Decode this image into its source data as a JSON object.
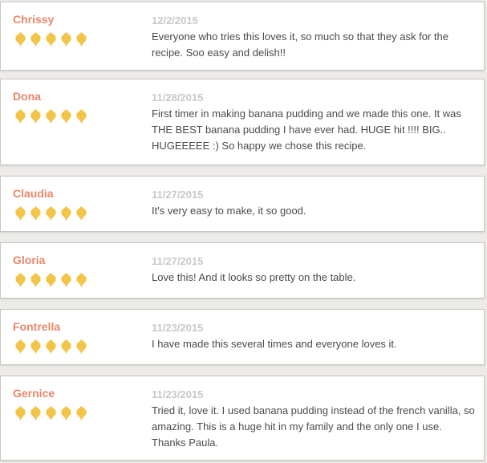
{
  "colors": {
    "name": "#e8866a",
    "date": "#c8c8c8",
    "text": "#4a4a4a",
    "star": "#f2c44a"
  },
  "reviews": [
    {
      "name": "Chrissy",
      "rating": 5,
      "date": "12/2/2015",
      "text": "Everyone who tries this loves it, so much so that they ask for the recipe. Soo easy and delish!!"
    },
    {
      "name": "Dona",
      "rating": 5,
      "date": "11/28/2015",
      "text": "First timer in making banana pudding and we made this one. It was THE BEST banana pudding I have ever had. HUGE hit !!!! BIG.. HUGEEEEE :) So happy we chose this recipe."
    },
    {
      "name": "Claudia",
      "rating": 5,
      "date": "11/27/2015",
      "text": "It's very easy to make, it so good."
    },
    {
      "name": "Gloria",
      "rating": 5,
      "date": "11/27/2015",
      "text": "Love this! And it looks so pretty on the table."
    },
    {
      "name": "Fontrella",
      "rating": 5,
      "date": "11/23/2015",
      "text": "I have made this several times and everyone loves it."
    },
    {
      "name": "Gernice",
      "rating": 5,
      "date": "11/23/2015",
      "text": "Tried it, love it. I used banana pudding instead of the french vanilla, so amazing. This is a huge hit in my family and the only one I use. Thanks Paula."
    }
  ]
}
